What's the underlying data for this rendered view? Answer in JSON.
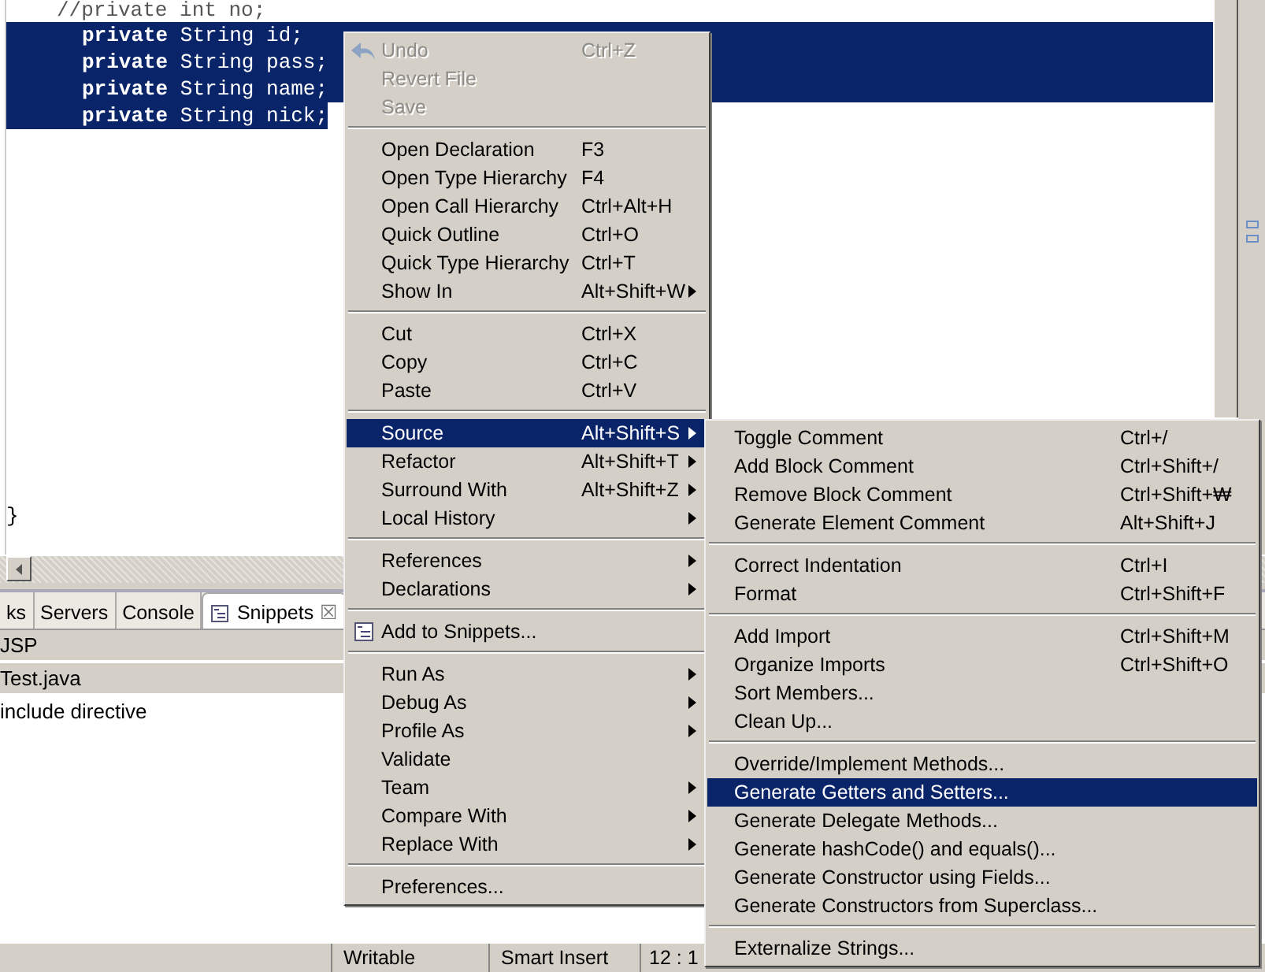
{
  "editor": {
    "lines": [
      {
        "kind": "comment",
        "text": "//private int no;",
        "selected": false
      },
      {
        "kind": "code",
        "text": "**private** String id;",
        "selected": true
      },
      {
        "kind": "code",
        "text": "**private** String pass;",
        "selected": true
      },
      {
        "kind": "code",
        "text": "**private** String name;",
        "selected": true
      },
      {
        "kind": "code",
        "text": "**private** String nick;",
        "selected": true
      },
      {
        "kind": "brace",
        "text": "}",
        "selected": false
      }
    ]
  },
  "bottom_panel": {
    "tabs": [
      {
        "label": "ks",
        "selected": false
      },
      {
        "label": "Servers",
        "selected": false
      },
      {
        "label": "Console",
        "selected": false
      },
      {
        "label": "Snippets",
        "selected": true,
        "close": "☒"
      }
    ],
    "snippets": [
      {
        "kind": "category",
        "label": "JSP"
      },
      {
        "kind": "category",
        "label": "Test.java"
      },
      {
        "kind": "item",
        "label": "include directive"
      }
    ]
  },
  "status_bar": [
    "Writable",
    "Smart Insert",
    "12 : 1"
  ],
  "context_menu": {
    "groups": [
      {
        "items": [
          {
            "label": "Undo",
            "shortcut": "Ctrl+Z",
            "disabled": true,
            "selected": false,
            "submenu": false
          },
          {
            "label": "Revert File",
            "disabled": true,
            "selected": false,
            "submenu": false
          },
          {
            "label": "Save",
            "disabled": true,
            "selected": false,
            "submenu": false
          }
        ]
      },
      {
        "items": [
          {
            "label": "Open Declaration",
            "shortcut": "F3",
            "disabled": false,
            "selected": false,
            "submenu": false
          },
          {
            "label": "Open Type Hierarchy",
            "shortcut": "F4",
            "disabled": false,
            "selected": false,
            "submenu": false
          },
          {
            "label": "Open Call Hierarchy",
            "shortcut": "Ctrl+Alt+H",
            "disabled": false,
            "selected": false,
            "submenu": false
          },
          {
            "label": "Quick Outline",
            "shortcut": "Ctrl+O",
            "disabled": false,
            "selected": false,
            "submenu": false
          },
          {
            "label": "Quick Type Hierarchy",
            "shortcut": "Ctrl+T",
            "disabled": false,
            "selected": false,
            "submenu": false
          },
          {
            "label": "Show In",
            "shortcut": "Alt+Shift+W",
            "disabled": false,
            "selected": false,
            "submenu": true
          }
        ]
      },
      {
        "items": [
          {
            "label": "Cut",
            "shortcut": "Ctrl+X",
            "disabled": false,
            "selected": false,
            "submenu": false
          },
          {
            "label": "Copy",
            "shortcut": "Ctrl+C",
            "disabled": false,
            "selected": false,
            "submenu": false
          },
          {
            "label": "Paste",
            "shortcut": "Ctrl+V",
            "disabled": false,
            "selected": false,
            "submenu": false
          }
        ]
      },
      {
        "items": [
          {
            "label": "Source",
            "shortcut": "Alt+Shift+S",
            "disabled": false,
            "selected": true,
            "submenu": true
          },
          {
            "label": "Refactor",
            "shortcut": "Alt+Shift+T",
            "disabled": false,
            "selected": false,
            "submenu": true
          },
          {
            "label": "Surround With",
            "shortcut": "Alt+Shift+Z",
            "disabled": false,
            "selected": false,
            "submenu": true
          },
          {
            "label": "Local History",
            "disabled": false,
            "selected": false,
            "submenu": true
          }
        ]
      },
      {
        "items": [
          {
            "label": "References",
            "disabled": false,
            "selected": false,
            "submenu": true
          },
          {
            "label": "Declarations",
            "disabled": false,
            "selected": false,
            "submenu": true
          }
        ]
      },
      {
        "items": [
          {
            "label": "Add to Snippets...",
            "disabled": false,
            "selected": false,
            "submenu": false
          }
        ]
      },
      {
        "items": [
          {
            "label": "Run As",
            "disabled": false,
            "selected": false,
            "submenu": true
          },
          {
            "label": "Debug As",
            "disabled": false,
            "selected": false,
            "submenu": true
          },
          {
            "label": "Profile As",
            "disabled": false,
            "selected": false,
            "submenu": true
          },
          {
            "label": "Validate",
            "disabled": false,
            "selected": false,
            "submenu": false
          },
          {
            "label": "Team",
            "disabled": false,
            "selected": false,
            "submenu": true
          },
          {
            "label": "Compare With",
            "disabled": false,
            "selected": false,
            "submenu": true
          },
          {
            "label": "Replace With",
            "disabled": false,
            "selected": false,
            "submenu": true
          }
        ]
      },
      {
        "items": [
          {
            "label": "Preferences...",
            "disabled": false,
            "selected": false,
            "submenu": false
          }
        ]
      }
    ]
  },
  "source_submenu": {
    "groups": [
      {
        "items": [
          {
            "label": "Toggle Comment",
            "shortcut": "Ctrl+/",
            "selected": false
          },
          {
            "label": "Add Block Comment",
            "shortcut": "Ctrl+Shift+/",
            "selected": false
          },
          {
            "label": "Remove Block Comment",
            "shortcut": "Ctrl+Shift+₩",
            "selected": false
          },
          {
            "label": "Generate Element Comment",
            "shortcut": "Alt+Shift+J",
            "selected": false
          }
        ]
      },
      {
        "items": [
          {
            "label": "Correct Indentation",
            "shortcut": "Ctrl+I",
            "selected": false
          },
          {
            "label": "Format",
            "shortcut": "Ctrl+Shift+F",
            "selected": false
          }
        ]
      },
      {
        "items": [
          {
            "label": "Add Import",
            "shortcut": "Ctrl+Shift+M",
            "selected": false
          },
          {
            "label": "Organize Imports",
            "shortcut": "Ctrl+Shift+O",
            "selected": false
          },
          {
            "label": "Sort Members...",
            "selected": false
          },
          {
            "label": "Clean Up...",
            "selected": false
          }
        ]
      },
      {
        "items": [
          {
            "label": "Override/Implement Methods...",
            "selected": false
          },
          {
            "label": "Generate Getters and Setters...",
            "selected": true
          },
          {
            "label": "Generate Delegate Methods...",
            "selected": false
          },
          {
            "label": "Generate hashCode() and equals()...",
            "selected": false
          },
          {
            "label": "Generate Constructor using Fields...",
            "selected": false
          },
          {
            "label": "Generate Constructors from Superclass...",
            "selected": false
          }
        ]
      },
      {
        "items": [
          {
            "label": "Externalize Strings...",
            "selected": false
          }
        ]
      }
    ]
  }
}
